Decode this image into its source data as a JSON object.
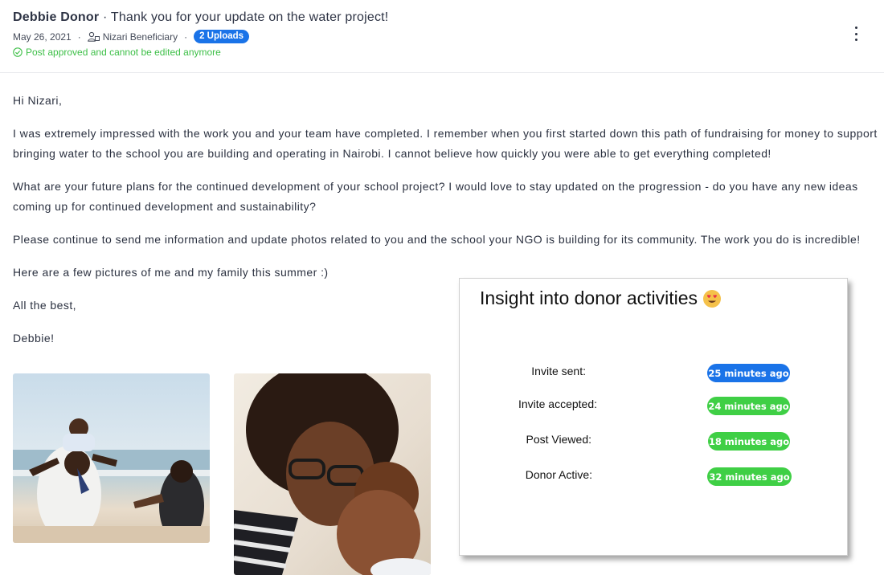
{
  "header": {
    "author": "Debbie Donor",
    "separator": "·",
    "subject": "Thank you for your update on the water project!",
    "date": "May 26, 2021",
    "recipient": "Nizari Beneficiary",
    "uploads_badge": "2 Uploads",
    "status_text": "Post approved and cannot be edited anymore",
    "menu_icon": "kebab-menu-icon"
  },
  "message": {
    "paragraphs": [
      "Hi Nizari,",
      "I was extremely impressed with the work you and your team have completed. I remember when you first started down this path of fundraising for money to support bringing water to the school you are building and operating in Nairobi. I cannot believe how quickly you were able to get everything completed!",
      "What are your future plans for the continued development of your school project? I would love to stay updated on the progression - do you have any new ideas coming up for continued development and sustainability?",
      "Please continue to send me information and update photos related to you and the school your NGO is building for its community. The work you do is incredible!",
      "Here are a few pictures of me and my family this summer :)",
      "All the best,",
      "Debbie!"
    ]
  },
  "photos": [
    {
      "alt": "family at the beach"
    },
    {
      "alt": "mother holding child"
    }
  ],
  "insight": {
    "title": "Insight into donor activities",
    "emoji": "heart-eyes-emoji-icon",
    "rows": [
      {
        "label": "Invite sent:",
        "time": "25 minutes ago",
        "color": "#1a73e8"
      },
      {
        "label": "Invite accepted:",
        "time": "24 minutes ago",
        "color": "#3fcf45"
      },
      {
        "label": "Post Viewed:",
        "time": "18 minutes ago",
        "color": "#3fcf45"
      },
      {
        "label": "Donor Active:",
        "time": "32 minutes ago",
        "color": "#3fcf45"
      }
    ]
  },
  "colors": {
    "accent_blue": "#1a73e8",
    "success_green": "#3dbf47",
    "pill_green": "#3fcf45"
  }
}
